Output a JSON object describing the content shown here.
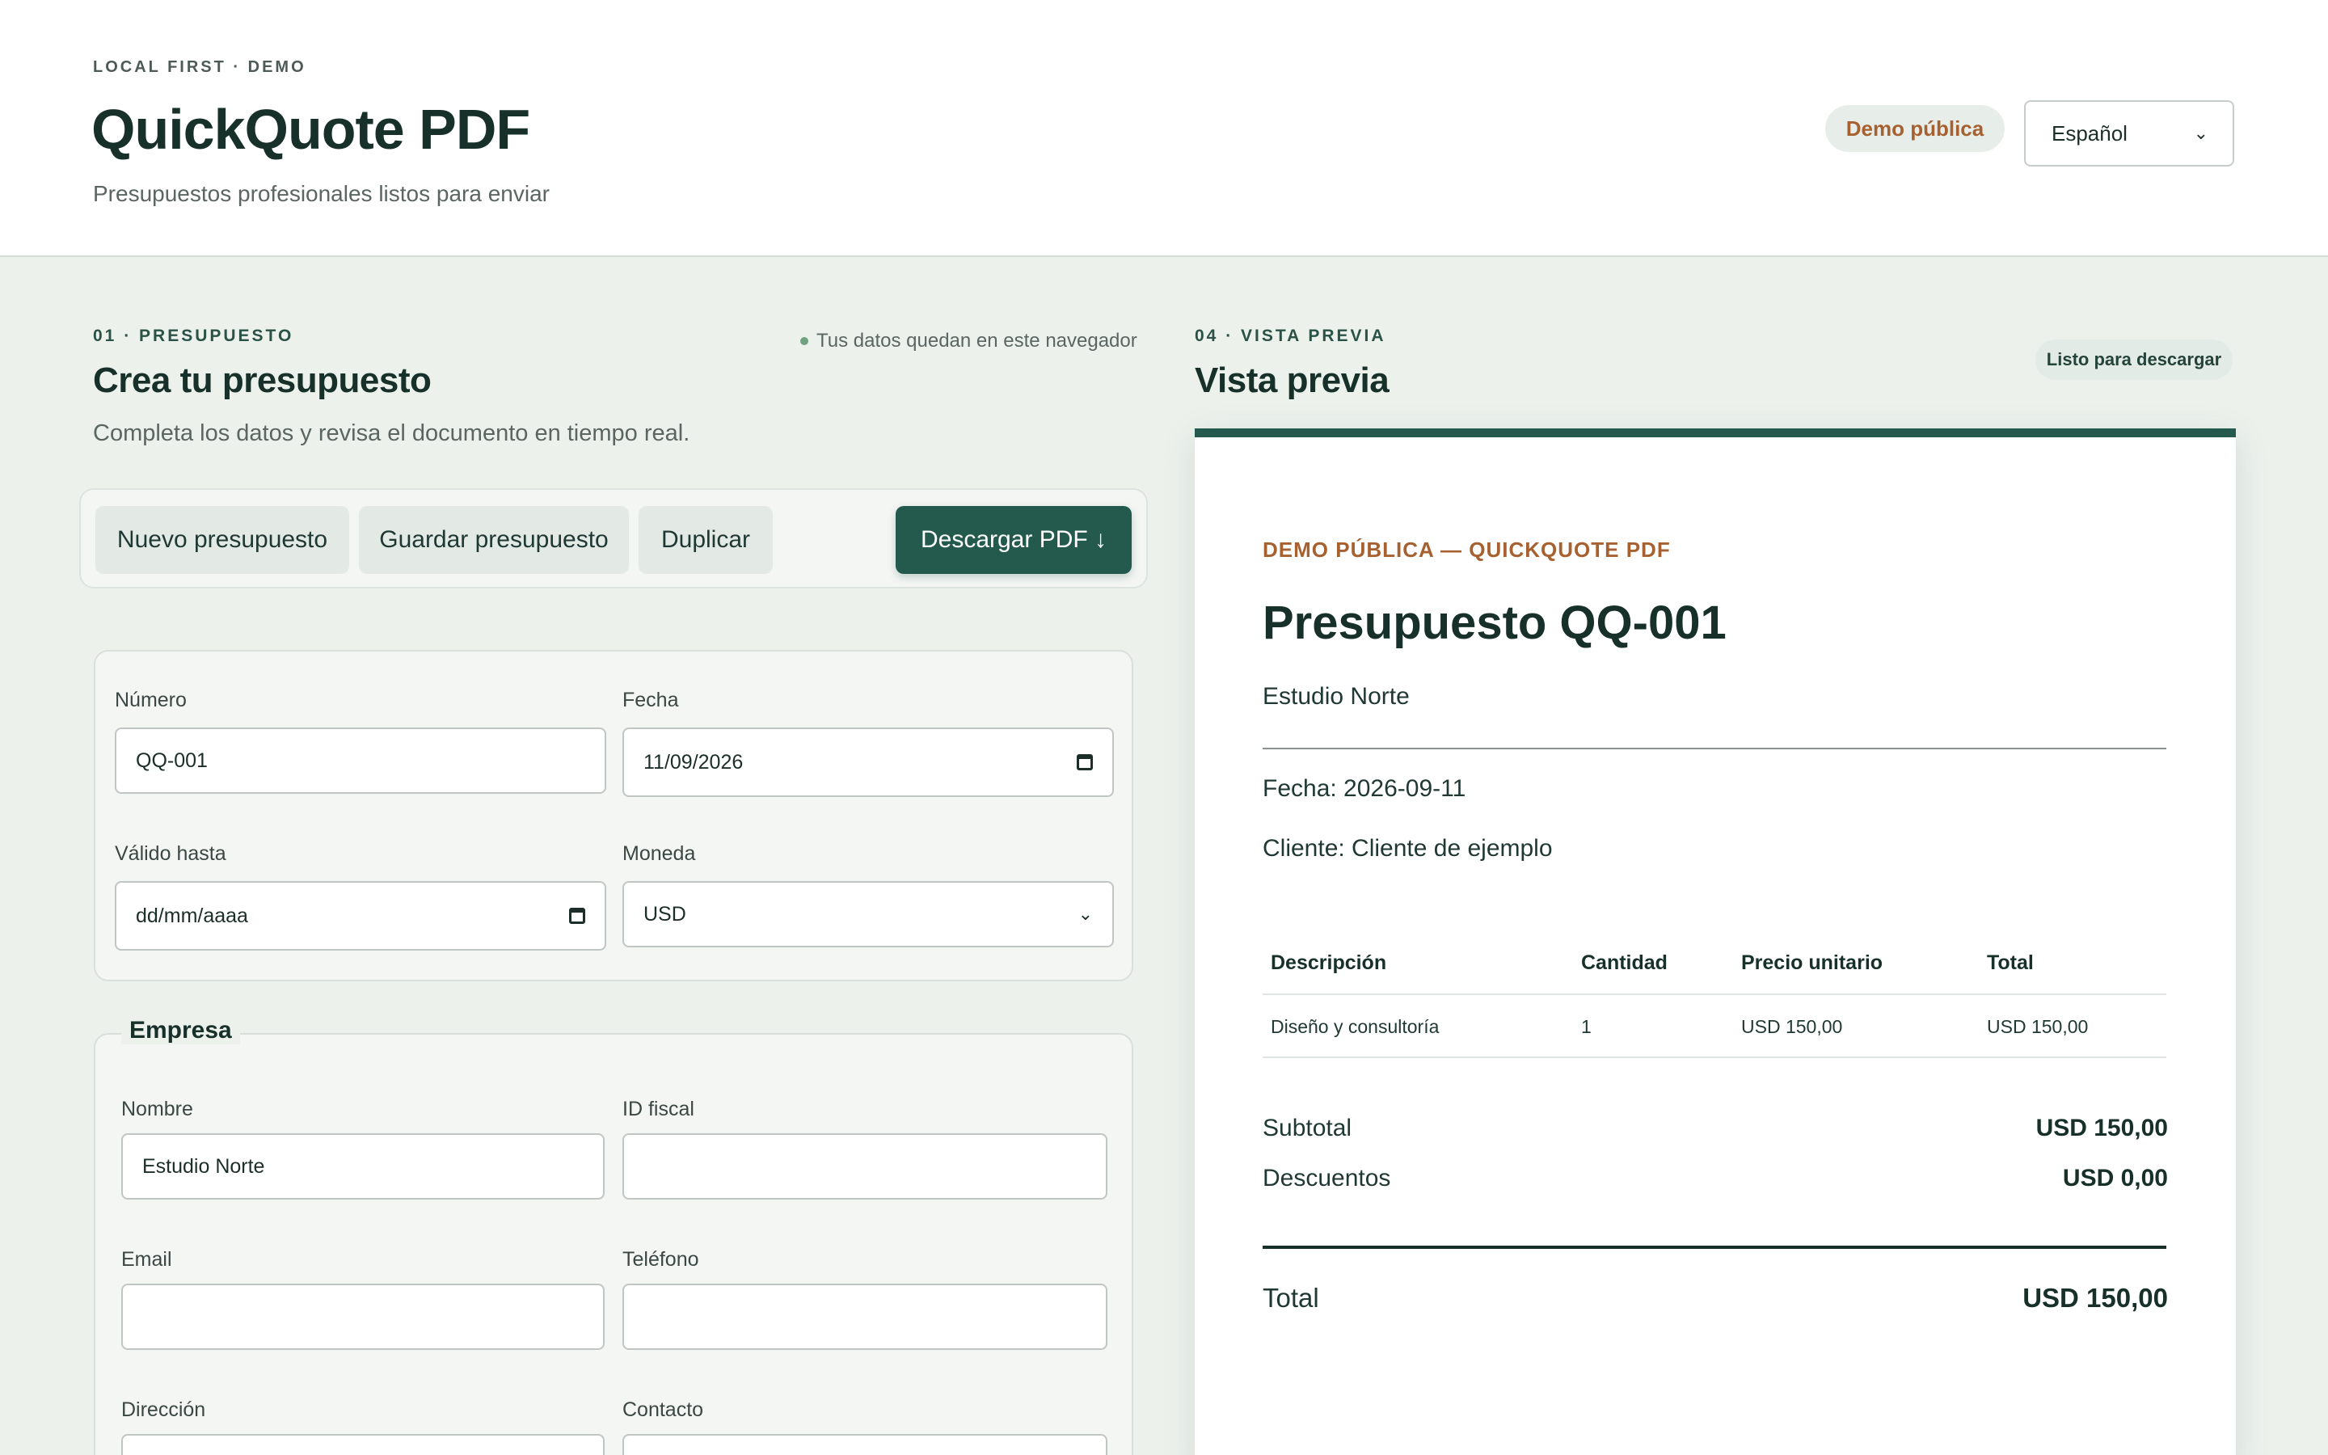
{
  "header": {
    "eyebrow": "LOCAL FIRST · DEMO",
    "title": "QuickQuote PDF",
    "subtitle": "Presupuestos profesionales listos para enviar",
    "demo_badge": "Demo pública",
    "language": "Español"
  },
  "editor": {
    "section_label": "01 · PRESUPUESTO",
    "title": "Crea tu presupuesto",
    "description": "Completa los datos y revisa el documento en tiempo real.",
    "local_note": "Tus datos quedan en este navegador",
    "toolbar": {
      "new": "Nuevo presupuesto",
      "save": "Guardar presupuesto",
      "duplicate": "Duplicar",
      "download": "Descargar PDF ↓"
    },
    "quote": {
      "number_label": "Número",
      "number_value": "QQ-001",
      "date_label": "Fecha",
      "date_value": "11/09/2026",
      "valid_label": "Válido hasta",
      "valid_value": "dd/mm/aaaa",
      "currency_label": "Moneda",
      "currency_value": "USD"
    },
    "company": {
      "legend": "Empresa",
      "name_label": "Nombre",
      "name_value": "Estudio Norte",
      "tax_label": "ID fiscal",
      "tax_value": "",
      "email_label": "Email",
      "email_value": "",
      "phone_label": "Teléfono",
      "phone_value": "",
      "address_label": "Dirección",
      "contact_label": "Contacto"
    }
  },
  "preview": {
    "section_label": "04 · VISTA PREVIA",
    "title": "Vista previa",
    "ready_badge": "Listo para descargar",
    "doc": {
      "eyebrow": "DEMO PÚBLICA — QUICKQUOTE PDF",
      "title": "Presupuesto QQ-001",
      "company": "Estudio Norte",
      "date_line": "Fecha: 2026-09-11",
      "client_line": "Cliente: Cliente de ejemplo",
      "columns": [
        "Descripción",
        "Cantidad",
        "Precio unitario",
        "Total"
      ],
      "rows": [
        [
          "Diseño y consultoría",
          "1",
          "USD 150,00",
          "USD 150,00"
        ]
      ],
      "subtotal_label": "Subtotal",
      "subtotal_value": "USD 150,00",
      "discount_label": "Descuentos",
      "discount_value": "USD 0,00",
      "total_label": "Total",
      "total_value": "USD 150,00"
    }
  },
  "colors": {
    "accent": "#245a4e",
    "brand_orange": "#a7602f",
    "background": "#ecf1ec"
  }
}
